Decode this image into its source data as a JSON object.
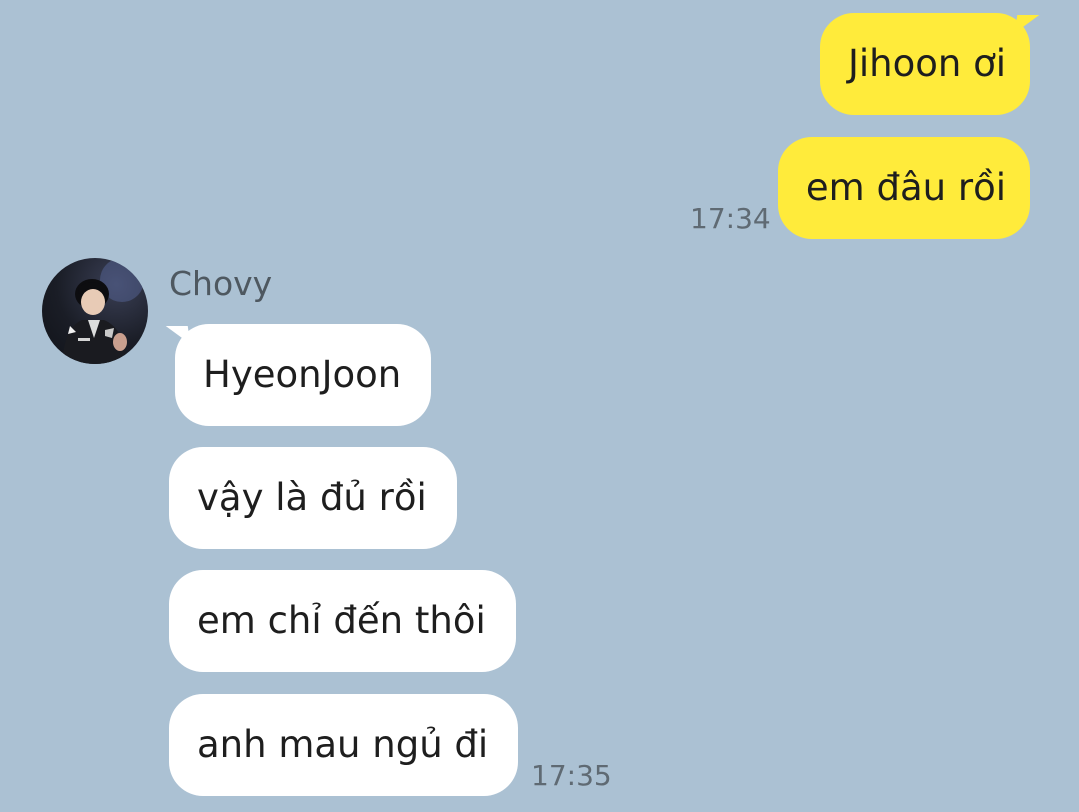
{
  "chat": {
    "background_color": "#abc1d3",
    "outgoing": {
      "bubble_color": "#ffeb3b",
      "messages": [
        {
          "text": "Jihoon ơi"
        },
        {
          "text": "em đâu rồi"
        }
      ],
      "timestamp": "17:34"
    },
    "incoming": {
      "sender": {
        "name": "Chovy",
        "avatar_icon": "profile-photo"
      },
      "bubble_color": "#ffffff",
      "messages": [
        {
          "text": "HyeonJoon"
        },
        {
          "text": "vậy là đủ rồi"
        },
        {
          "text": "em chỉ đến thôi"
        },
        {
          "text": "anh mau ngủ đi"
        }
      ],
      "timestamp": "17:35"
    }
  }
}
